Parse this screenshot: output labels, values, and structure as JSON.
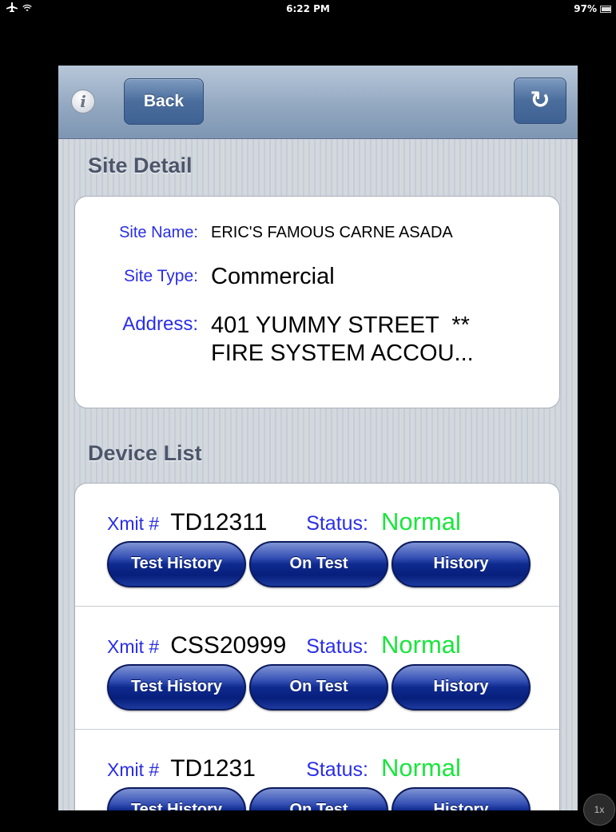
{
  "status_bar": {
    "airplane_icon": "airplane-icon",
    "wifi_icon": "wifi-icon",
    "time": "6:22 PM",
    "battery": "97%"
  },
  "navbar": {
    "info_glyph": "i",
    "back_label": "Back",
    "refresh_glyph": "↻"
  },
  "site_detail": {
    "header": "Site Detail",
    "fields": [
      {
        "label": "Site Name:",
        "value": "ERIC'S FAMOUS CARNE ASADA"
      },
      {
        "label": "Site Type:",
        "value": "Commercial"
      },
      {
        "label": "Address:",
        "value": "401 YUMMY STREET  **",
        "value2": "FIRE SYSTEM ACCOU..."
      }
    ]
  },
  "device_list": {
    "header": "Device List",
    "xmit_label": "Xmit #",
    "status_label": "Status:",
    "buttons": {
      "test_history": "Test History",
      "on_test": "On Test",
      "history": "History"
    },
    "devices": [
      {
        "xmit": "TD12311",
        "status": "Normal"
      },
      {
        "xmit": "CSS20999",
        "status": "Normal"
      },
      {
        "xmit": "TD1231",
        "status": "Normal"
      }
    ]
  },
  "zoom_badge": "1x",
  "colors": {
    "label_blue": "#2a2ee6",
    "status_green": "#19e63c",
    "button_navy": "#0f2a8f"
  }
}
